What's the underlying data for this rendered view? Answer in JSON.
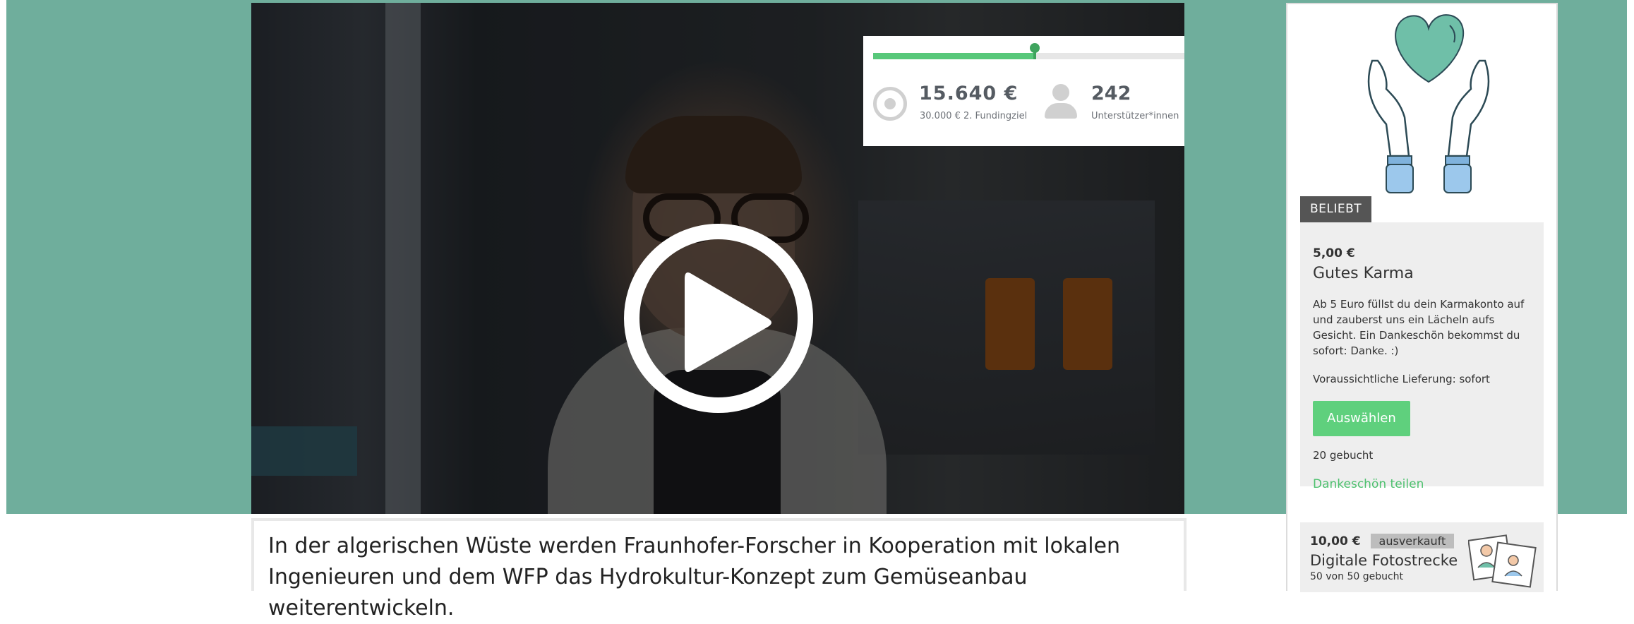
{
  "video": {
    "play_icon": "play-icon"
  },
  "funding": {
    "amount": "15.640 €",
    "goal": "30.000 € 2. Fundingziel",
    "supporters": "242",
    "supporters_label": "Unterstützer*innen",
    "progress_fraction": 0.52,
    "progress_color": "#58c87a"
  },
  "caption": {
    "text": "In der algerischen Wüste werden Fraunhofer-Forscher in Kooperation mit lokalen Ingenieuren und dem WFP das Hydrokultur-Konzept zum Gemüseanbau weiterentwickeln."
  },
  "sidebar": {
    "illustration": "heart-hands-illustration",
    "badge": "BELIEBT",
    "reward1": {
      "price": "5,00 €",
      "title": "Gutes Karma",
      "description": "Ab 5 Euro füllst du dein Karmakonto auf und zauberst uns ein Lächeln aufs Gesicht. Ein Dankeschön bekommst du sofort: Danke. :)",
      "delivery": "Voraussichtliche Lieferung: sofort",
      "button": "Auswählen",
      "booked": "20 gebucht",
      "share": "Dankeschön teilen"
    },
    "reward2": {
      "price": "10,00 €",
      "status": "ausverkauft",
      "title": "Digitale Fotostrecke",
      "booked": "50 von 50 gebucht",
      "thumbnail": "photo-thumbnail"
    }
  },
  "colors": {
    "banner": "#6fae9c",
    "accent_green": "#5fd07d",
    "link_green": "#4ec16f"
  }
}
